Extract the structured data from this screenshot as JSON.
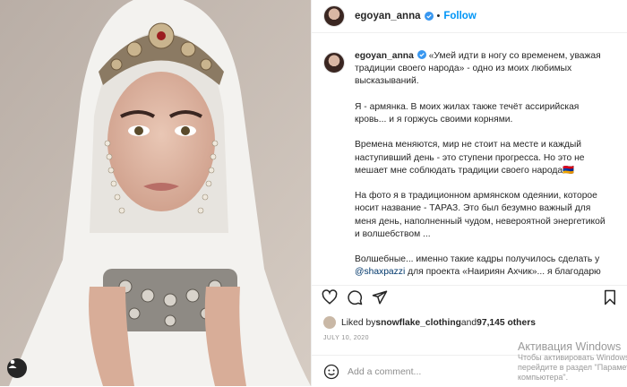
{
  "post": {
    "username": "egoyan_anna",
    "separator": "•",
    "follow_label": "Follow",
    "caption_paragraphs": [
      "«Умей идти в ногу со временем, уважая традиции своего народа» - одно из моих любимых высказываний.",
      "Я - армянка. В моих жилах также течёт ассирийская кровь... и я горжусь своими корнями.",
      "Времена меняются, мир не стоит на месте и каждый наступивший день - это ступени прогресса. Но это не мешает мне соблюдать традиции своего народа🇦🇲",
      "На фото я в традиционном армянском одеянии, которое носит название - ТАРАЗ. Это был безумно важный для меня день, наполненный чудом, невероятной энергетикой и волшебством ..."
    ],
    "caption_last_prefix": "Волшебные... именно такие кадры получилось сделать у ",
    "caption_mention": "@shaxpazzi",
    "caption_last_suffix": " для проекта «Наириян Ахчик»... я благодарю за возможность быть частью чего-то очень важного и бесконечно сильного 🖤",
    "liked_by_prefix": "Liked by ",
    "liked_by_user": "snowflake_clothing",
    "liked_by_and": " and ",
    "liked_by_count": "97,145 others",
    "date": "JULY 10, 2020",
    "comment_placeholder": "Add a comment..."
  },
  "watermark": {
    "line1": "Активация Windows",
    "line2": "Чтобы активировать Windows, перейдите в раздел \"Параметры компьютера\"."
  },
  "colors": {
    "link": "#0095f6",
    "mention": "#00376b",
    "muted": "#8e8e8e",
    "verified": "#3897f0"
  },
  "icons": [
    "heart-icon",
    "comment-icon",
    "share-icon",
    "bookmark-icon",
    "emoji-icon",
    "user-tag-icon",
    "verified-badge-icon"
  ]
}
